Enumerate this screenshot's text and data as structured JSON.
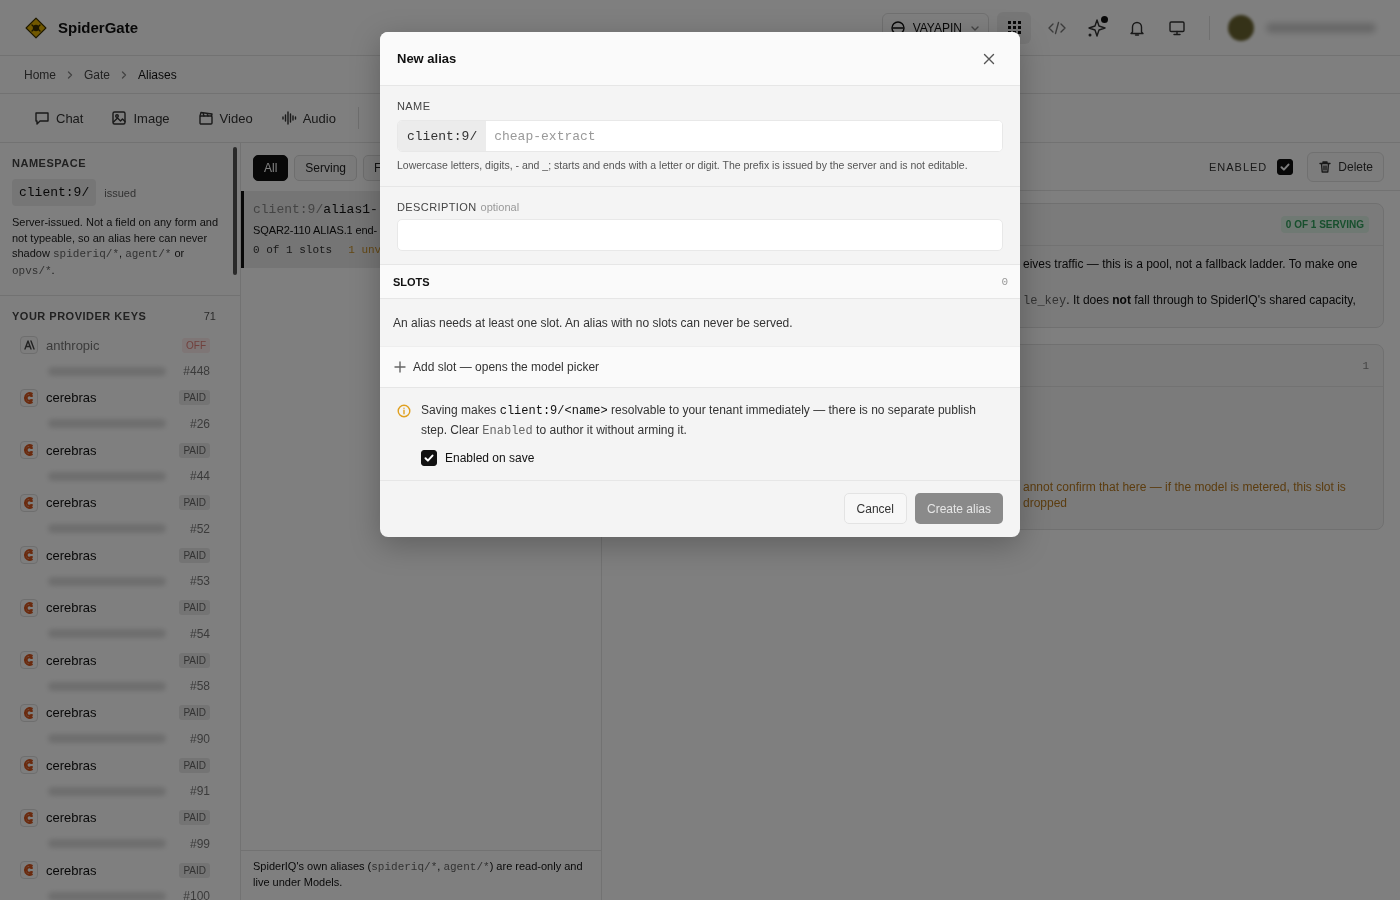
{
  "app": {
    "name": "SpiderGate"
  },
  "header": {
    "workspace": "VAYAPIN",
    "has_notification": true
  },
  "breadcrumb": [
    "Home",
    "Gate",
    "Aliases"
  ],
  "tabs": [
    {
      "label": "Chat",
      "kind": "chat"
    },
    {
      "label": "Image",
      "kind": "image"
    },
    {
      "label": "Video",
      "kind": "video"
    },
    {
      "label": "Audio",
      "kind": "audio"
    }
  ],
  "sidebar": {
    "namespace": {
      "label": "NAMESPACE",
      "prefix": "client:9/",
      "tag": "issued",
      "note": [
        {
          "text": "Server-issued. Not a field on any form and not typeable, so an alias here can never shadow ",
          "kind": "plain"
        },
        {
          "text": "spideriq/*",
          "kind": "code-dim"
        },
        {
          "text": ", ",
          "kind": "plain"
        },
        {
          "text": "agent/*",
          "kind": "code-dim"
        },
        {
          "text": " or ",
          "kind": "plain"
        },
        {
          "text": "opvs/*",
          "kind": "code-dim"
        },
        {
          "text": ".",
          "kind": "plain"
        }
      ]
    },
    "keys": {
      "label": "YOUR PROVIDER KEYS",
      "count": "71",
      "items": [
        {
          "kind": "letter-mark",
          "name": "anthropic",
          "badge": "OFF",
          "disabled": true,
          "number": "#448"
        },
        {
          "kind": "swirl",
          "name": "cerebras",
          "badge": "PAID",
          "disabled": false,
          "number": "#26"
        },
        {
          "kind": "swirl",
          "name": "cerebras",
          "badge": "PAID",
          "disabled": false,
          "number": "#44"
        },
        {
          "kind": "swirl",
          "name": "cerebras",
          "badge": "PAID",
          "disabled": false,
          "number": "#52"
        },
        {
          "kind": "swirl",
          "name": "cerebras",
          "badge": "PAID",
          "disabled": false,
          "number": "#53"
        },
        {
          "kind": "swirl",
          "name": "cerebras",
          "badge": "PAID",
          "disabled": false,
          "number": "#54"
        },
        {
          "kind": "swirl",
          "name": "cerebras",
          "badge": "PAID",
          "disabled": false,
          "number": "#58"
        },
        {
          "kind": "swirl",
          "name": "cerebras",
          "badge": "PAID",
          "disabled": false,
          "number": "#90"
        },
        {
          "kind": "swirl",
          "name": "cerebras",
          "badge": "PAID",
          "disabled": false,
          "number": "#91"
        },
        {
          "kind": "swirl",
          "name": "cerebras",
          "badge": "PAID",
          "disabled": false,
          "number": "#99"
        },
        {
          "kind": "swirl",
          "name": "cerebras",
          "badge": "PAID",
          "disabled": false,
          "number": "#100"
        }
      ]
    }
  },
  "list": {
    "filters": [
      {
        "label": "All",
        "selected": true
      },
      {
        "label": "Serving",
        "selected": false
      },
      {
        "label": "F",
        "selected": false
      }
    ],
    "items": [
      {
        "prefix": "client:9/",
        "name": "alias1-",
        "description": "SQAR2-110 ALIAS.1 end-",
        "slots": "0 of 1 slots",
        "warning": "1 unv",
        "selected": true
      }
    ],
    "footer": [
      {
        "text": "SpiderIQ's own aliases (",
        "kind": "plain"
      },
      {
        "text": "spideriq/*",
        "kind": "code-dim"
      },
      {
        "text": ", ",
        "kind": "plain"
      },
      {
        "text": "agent/*",
        "kind": "code-dim"
      },
      {
        "text": ") are read-only and live under Models.",
        "kind": "plain"
      }
    ]
  },
  "detail": {
    "enabled_label": "ENABLED",
    "enabled": true,
    "delete": "Delete",
    "cards": [
      {
        "badge": "0 OF 1 SERVING",
        "lines": [
          [
            {
              "text": "eives traffic — this is a pool, not a fallback ladder. To make one",
              "kind": "plain"
            }
          ],
          [
            {
              "text": "le_key",
              "kind": "code-dim"
            },
            {
              "text": ". It does ",
              "kind": "plain"
            },
            {
              "text": "not",
              "kind": "bold"
            },
            {
              "text": " fall through to SpiderIQ's shared capacity,",
              "kind": "plain"
            }
          ]
        ]
      },
      {
        "count": "1",
        "lines": [
          [
            {
              "text": "annot confirm that here — if the model is metered, this slot is dropped",
              "kind": "warning"
            }
          ]
        ]
      }
    ]
  },
  "modal": {
    "title": "New alias",
    "name_label": "NAME",
    "prefix": "client:9/",
    "name_placeholder": "cheap-extract",
    "name_hint": "Lowercase letters, digits, - and _; starts and ends with a letter or digit. The prefix is issued by the server and is not editable.",
    "description_label": "DESCRIPTION",
    "description_optional": "optional",
    "slots_label": "SLOTS",
    "slots_count": "0",
    "slots_empty": "An alias needs at least one slot. An alias with no slots can never be served.",
    "add_slot": "Add slot — opens the model picker",
    "notice": [
      {
        "text": "Saving makes ",
        "kind": "plain"
      },
      {
        "text": "client:9/<name>",
        "kind": "code"
      },
      {
        "text": " resolvable to your tenant immediately — there is no separate publish step. Clear ",
        "kind": "plain"
      },
      {
        "text": "Enabled",
        "kind": "code-dim"
      },
      {
        "text": " to author it without arming it.",
        "kind": "plain"
      }
    ],
    "enabled_on_save": {
      "label": "Enabled on save",
      "checked": true
    },
    "buttons": [
      {
        "label": "Cancel",
        "kind": "secondary",
        "disabled": false
      },
      {
        "label": "Create alias",
        "kind": "primary",
        "disabled": true
      }
    ]
  }
}
